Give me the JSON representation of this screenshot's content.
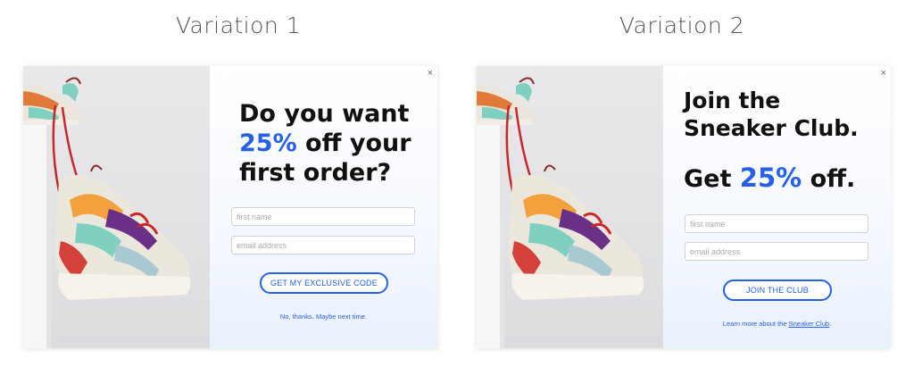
{
  "variation1": {
    "title": "Variation 1",
    "close_glyph": "×",
    "headline": {
      "line1": "Do you want",
      "accent": "25%",
      "line2_rest": " off your",
      "line3": "first order?"
    },
    "first_name_placeholder": "first name",
    "email_placeholder": "email address",
    "cta_label": "GET MY EXCLUSIVE CODE",
    "decline_text": "No, thanks. Maybe next time."
  },
  "variation2": {
    "title": "Variation 2",
    "close_glyph": "×",
    "headline": {
      "line1": "Join the",
      "line2": "Sneaker Club.",
      "line3_pre": "Get ",
      "accent": "25%",
      "line3_post": " off."
    },
    "first_name_placeholder": "first name",
    "email_placeholder": "email address",
    "cta_label": "JOIN THE CLUB",
    "footnote_pre": "Learn more about the ",
    "footnote_link": "Sneaker Club",
    "footnote_post": "."
  },
  "colors": {
    "accent": "#2460e8",
    "headline": "#111111"
  }
}
